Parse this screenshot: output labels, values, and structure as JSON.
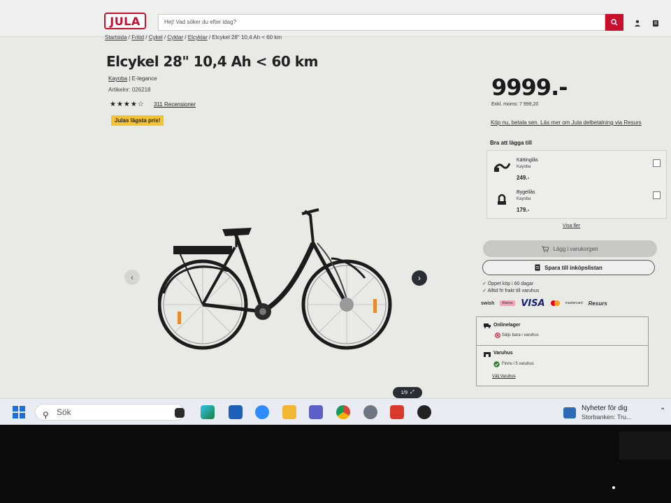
{
  "header": {
    "logo": "JULA",
    "search_placeholder": "Hej! Vad söker du efter idag?"
  },
  "breadcrumb": {
    "items": [
      "Startsida",
      "Fritid",
      "Cykel",
      "Cyklar",
      "Elcyklar"
    ],
    "current": "Elcykel 28\" 10,4 Ah < 60 km",
    "separator": " / "
  },
  "product": {
    "title": "Elcykel 28\" 10,4 Ah < 60 km",
    "brand": "Kayoba",
    "line": "| E-legance",
    "article_number": "Artikelnr: 026218",
    "rating_stars": "★★★★☆",
    "rating_value": 4.5,
    "reviews": "311 Recensioner",
    "promo_badge": "Julas lägsta pris!",
    "price": "9999.-",
    "price_ex_vat": "Exkl. moms: 7 999,20",
    "klarna_text": "Köp nu, betala sen. Läs mer om Jula delbetalning via Resurs"
  },
  "gallery": {
    "counter": "1/9"
  },
  "addons": {
    "title": "Bra att lägga till",
    "items": [
      {
        "name": "Kättinglås",
        "brand": "Kayoba",
        "price": "249.-"
      },
      {
        "name": "Bygellås",
        "brand": "Kayoba",
        "price": "179.-"
      }
    ],
    "show_more": "Visa fler"
  },
  "actions": {
    "add_to_cart": "Lägg i varukorgen",
    "save_list": "Spara till inköpslistan"
  },
  "usps": [
    "Öppet köp i 60 dagar",
    "Alltid fri frakt till varuhus"
  ],
  "payment": {
    "swish": "swish",
    "klarna": "Klarna.",
    "visa": "VISA",
    "mastercard": "mastercard",
    "resurs": "Resurs"
  },
  "stock": {
    "online_title": "Onlinelager",
    "online_status": "Säljs bara i varuhus",
    "store_title": "Varuhus",
    "store_status": "Finns i 5 varuhus",
    "choose_store": "Välj Varuhus"
  },
  "taskbar": {
    "search_placeholder": "Sök",
    "news_title": "Nyheter för dig",
    "news_sub": "Storbanken: Tru..."
  },
  "colors": {
    "brand_red": "#c8102e",
    "promo_yellow": "#f4c430",
    "success_green": "#2e7d32"
  }
}
